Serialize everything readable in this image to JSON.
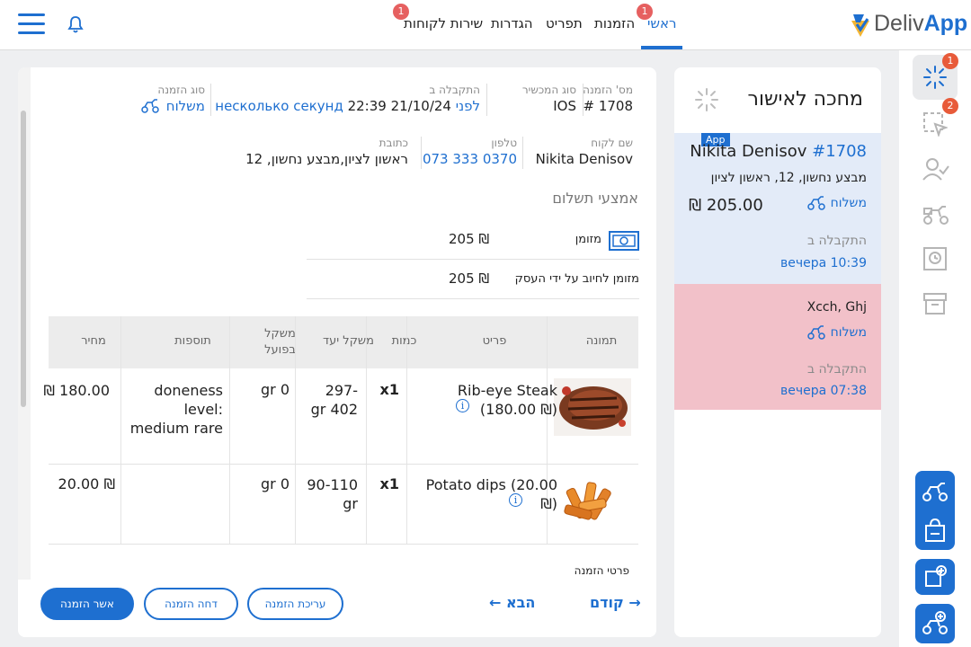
{
  "header": {
    "nav": [
      {
        "label": "ראשי",
        "active": true,
        "badge": "1"
      },
      {
        "label": "הזמנות",
        "active": false
      },
      {
        "label": "תפריט",
        "active": false
      },
      {
        "label": "הגדרות",
        "active": false
      },
      {
        "label": "שירות לקוחות",
        "active": false,
        "badge": "1"
      }
    ],
    "logo": {
      "part1": "Deliv",
      "part2": "App"
    }
  },
  "rail": {
    "badges": [
      "1",
      "2"
    ]
  },
  "waiting": {
    "title": "מחכה לאישור",
    "orders": [
      {
        "tag": "App",
        "name": "Nikita Denisov",
        "number": "#1708",
        "address": "מבצע נחשון, 12, ראשון לציון",
        "type": "משלוח",
        "price": "₪ 205.00",
        "received_label": "התקבלה ב",
        "time": "10:39 вечера"
      },
      {
        "name": "Xcch, Ghj",
        "type": "משלוח",
        "received_label": "התקבלה ב",
        "time": "07:38 вечера"
      }
    ]
  },
  "order": {
    "fields": {
      "number_label": "מס' הזמנה",
      "number": "1708 #",
      "device_label": "סוג המכשיר",
      "device": "IOS",
      "received_label": "התקבלה ב",
      "received_date": "22:39 21/10/24",
      "received_relative": "לפני несколько секунд",
      "type_label": "סוג הזמנה",
      "type": "משלוח",
      "customer_label": "שם לקוח",
      "customer": "Nikita Denisov",
      "phone_label": "טלפון",
      "phone": "0370 333 073",
      "address_label": "כתובת",
      "address": "ראשון לציון,מבצע נחשון, 12"
    },
    "payment_title": "אמצעי תשלום",
    "payments": [
      {
        "name": "מזומן",
        "amount": "205 ₪"
      },
      {
        "name": "מזומן לחיוב על ידי העסק",
        "amount": "205 ₪"
      }
    ],
    "table": {
      "headers": {
        "image": "תמונה",
        "item": "פריט",
        "qty": "כמות",
        "target_weight": "משקל יעד",
        "actual_weight": "משקל בפועל",
        "extras": "תוספות",
        "price": "מחיר"
      },
      "rows": [
        {
          "item": "Rib-eye Steak (180.00 ₪)",
          "qty": "x1",
          "target_weight": "297-402 gr",
          "actual_weight": "0 gr",
          "extras": "doneness level: medium rare",
          "price": "180.00 ₪"
        },
        {
          "item": "Potato dips (20.00 ₪)",
          "qty": "x1",
          "target_weight": "90-110 gr",
          "actual_weight": "0 gr",
          "extras": "",
          "price": "₪ 20.00"
        }
      ]
    },
    "details_label": "פרטי הזמנה",
    "footer": {
      "approve": "אשר הזמנה",
      "reject": "דחה הזמנה",
      "edit": "עריכת הזמנה",
      "next": "← הבא",
      "prev": "קודם →"
    }
  }
}
